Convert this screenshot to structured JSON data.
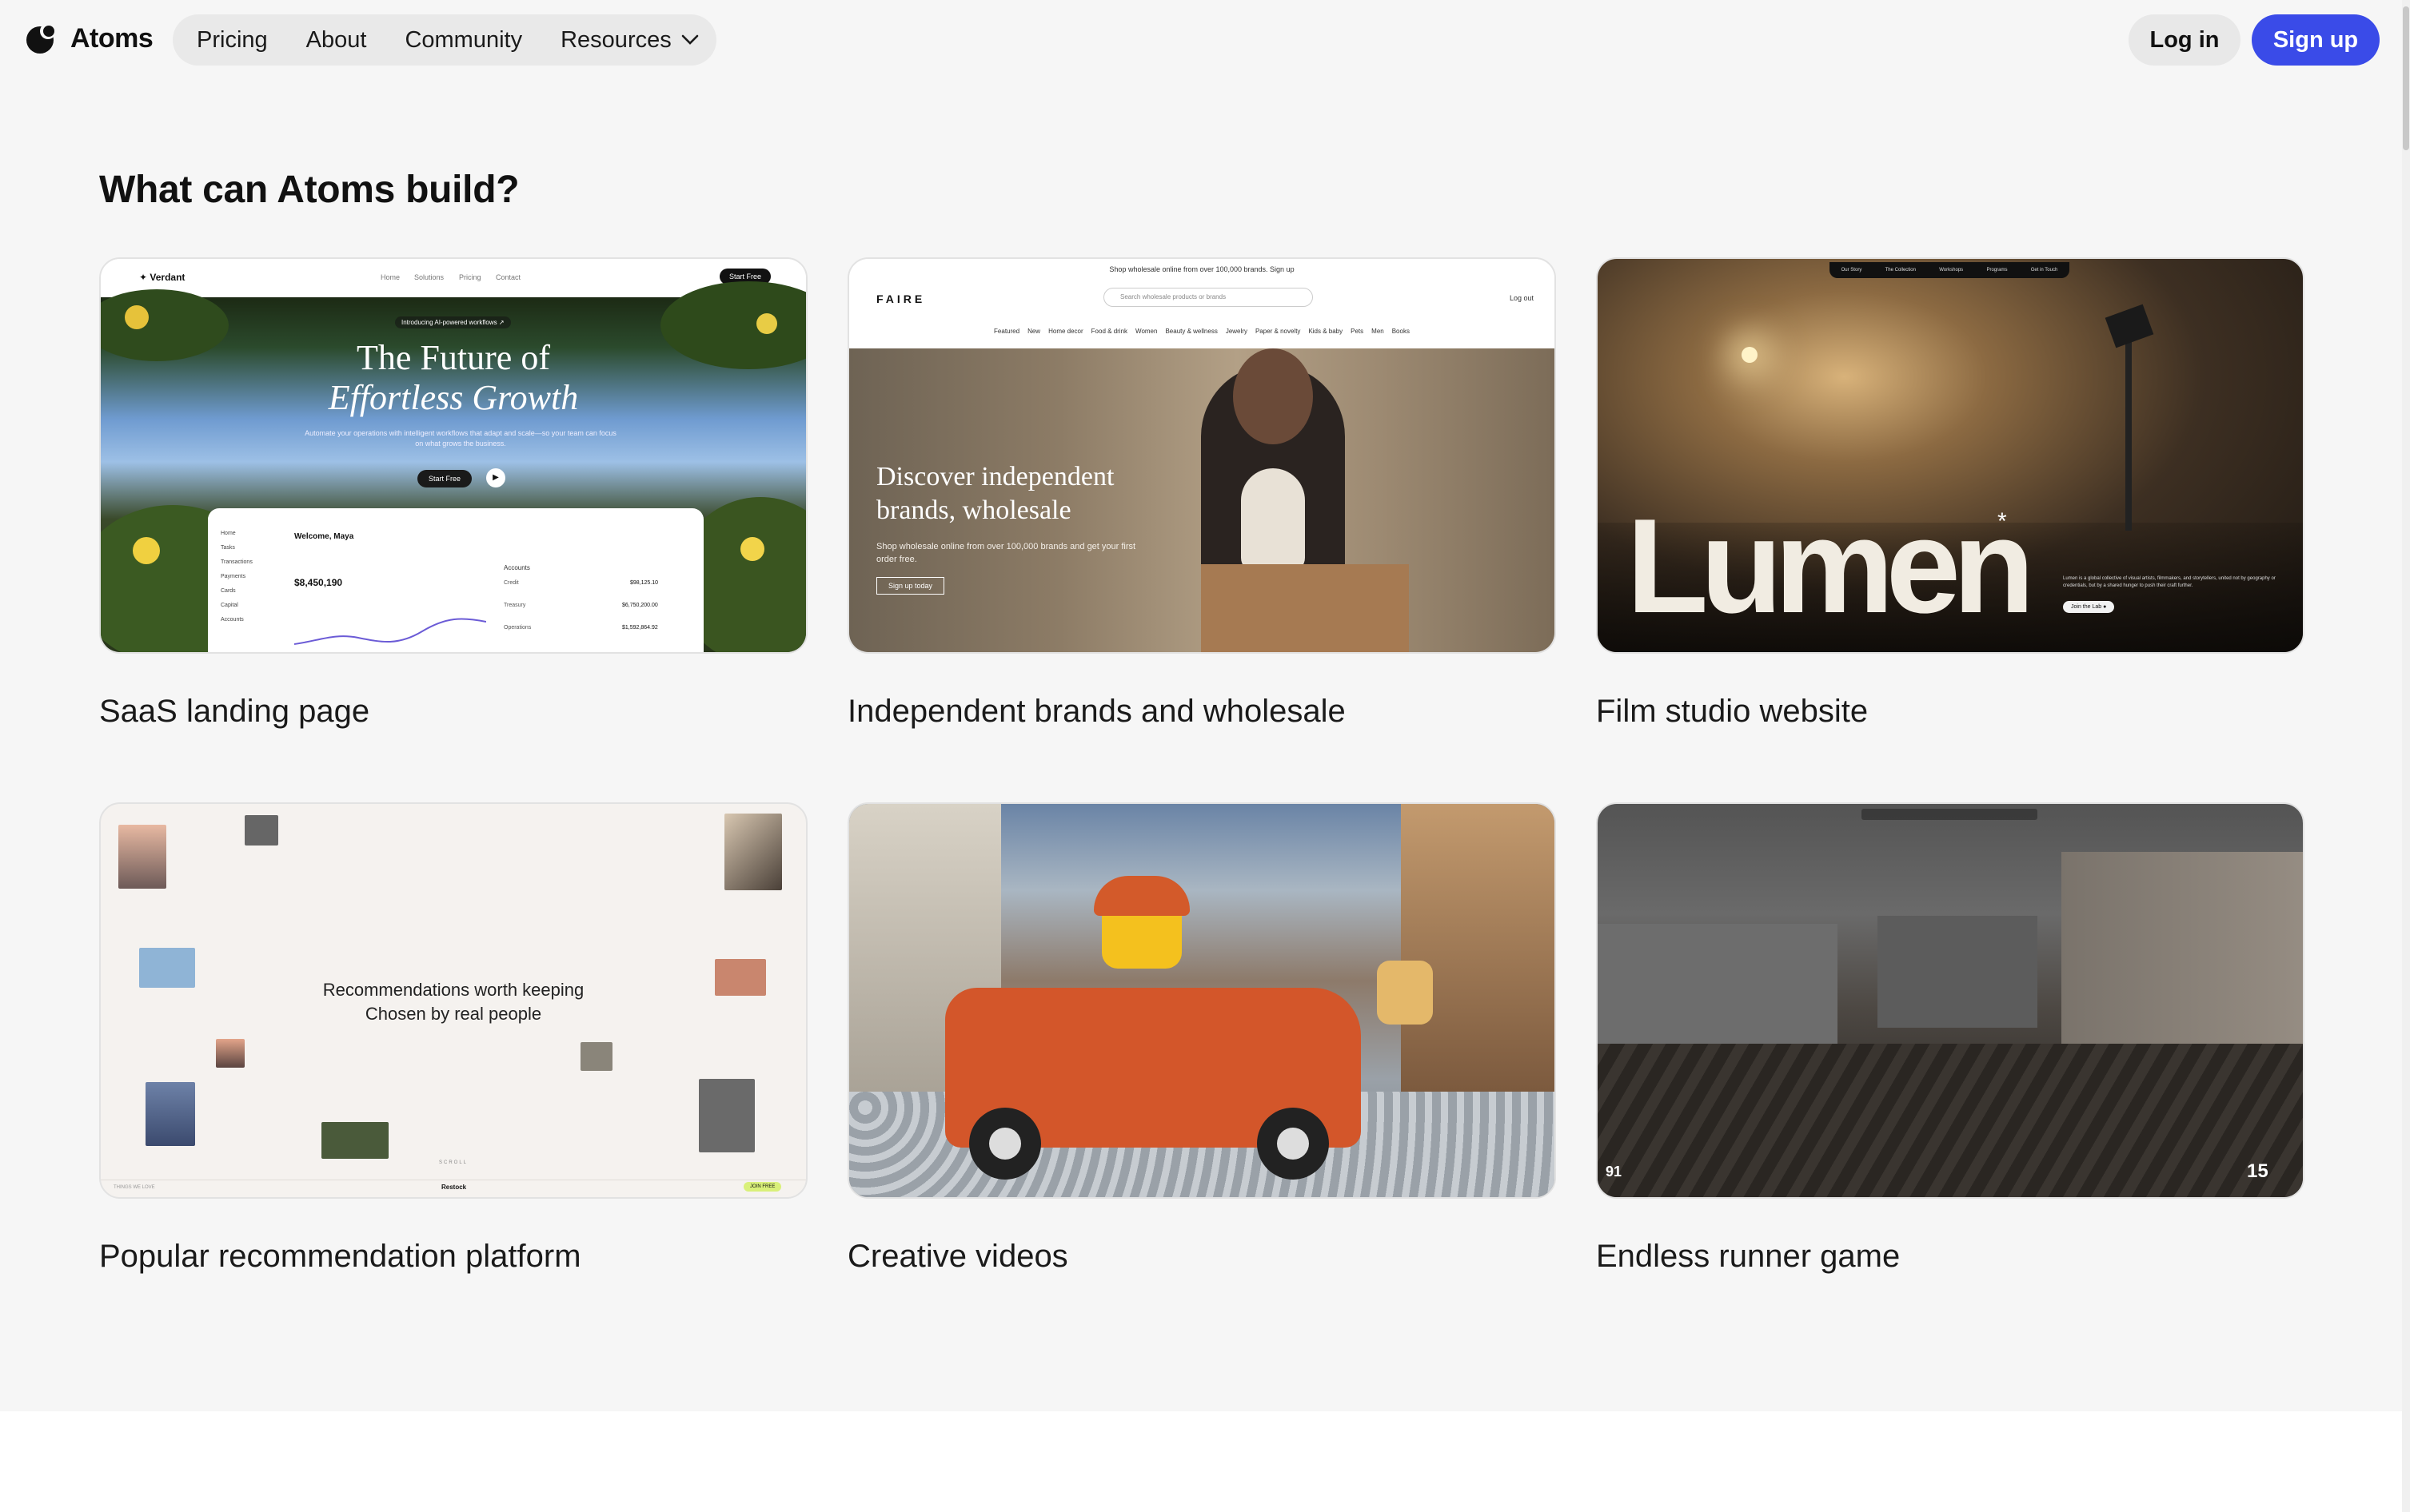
{
  "header": {
    "logo_text": "Atoms",
    "nav": [
      {
        "label": "Pricing"
      },
      {
        "label": "About"
      },
      {
        "label": "Community"
      },
      {
        "label": "Resources"
      }
    ],
    "login_label": "Log in",
    "signup_label": "Sign up",
    "accent_color": "#3a4be8"
  },
  "section": {
    "title": "What can Atoms build?"
  },
  "cards": [
    {
      "caption": "SaaS landing page",
      "preview": {
        "brand": "✦ Verdant",
        "nav": [
          "Home",
          "Solutions",
          "Pricing",
          "Contact"
        ],
        "cta": "Start Free",
        "badge": "Introducing AI-powered workflows ↗",
        "headline_1": "The Future of",
        "headline_2": "Effortless Growth",
        "sub": "Automate your operations with intelligent workflows that adapt and scale—so your team can focus on what grows the business.",
        "button": "Start Free",
        "dash_welcome": "Welcome, Maya",
        "dash_balance": "$8,450,190",
        "dash_side": [
          "Home",
          "Tasks",
          "Transactions",
          "Payments",
          "Cards",
          "Capital",
          "Accounts"
        ],
        "dash_accounts_title": "Accounts",
        "dash_accounts": [
          {
            "label": "Credit",
            "value": "$98,125.10"
          },
          {
            "label": "Treasury",
            "value": "$6,750,200.00"
          },
          {
            "label": "Operations",
            "value": "$1,592,864.92"
          }
        ]
      }
    },
    {
      "caption": "Independent brands and wholesale",
      "preview": {
        "banner": "Shop wholesale online from over 100,000 brands. Sign up",
        "brand": "FAIRE",
        "search": "Search wholesale products or brands",
        "logout": "Log out",
        "categories": [
          "Featured",
          "New",
          "Home decor",
          "Food & drink",
          "Women",
          "Beauty & wellness",
          "Jewelry",
          "Paper & novelty",
          "Kids & baby",
          "Pets",
          "Men",
          "Books"
        ],
        "headline": "Discover independent brands, wholesale",
        "sub": "Shop wholesale online from over 100,000 brands and get your first order free.",
        "button": "Sign up today"
      }
    },
    {
      "caption": "Film studio website",
      "preview": {
        "nav": [
          "Our Story",
          "The Collection",
          "Workshops",
          "Programs",
          "Get in Touch"
        ],
        "wordmark": "Lumen",
        "blurb": "Lumen is a global collective of visual artists, filmmakers, and storytellers, united not by geography or credentials, but by a shared hunger to push their craft further.",
        "button": "Join the Lab"
      }
    },
    {
      "caption": "Popular recommendation platform",
      "preview": {
        "line1": "Recommendations worth keeping",
        "line2": "Chosen by real people",
        "footer_left": "THINGS WE LOVE",
        "brand": "Restock",
        "footer_right": "JOIN FREE",
        "scroll_hint": "SCROLL"
      }
    },
    {
      "caption": "Creative videos",
      "preview": {}
    },
    {
      "caption": "Endless runner game",
      "preview": {
        "hud_left": "91",
        "hud_right": "15"
      }
    }
  ]
}
